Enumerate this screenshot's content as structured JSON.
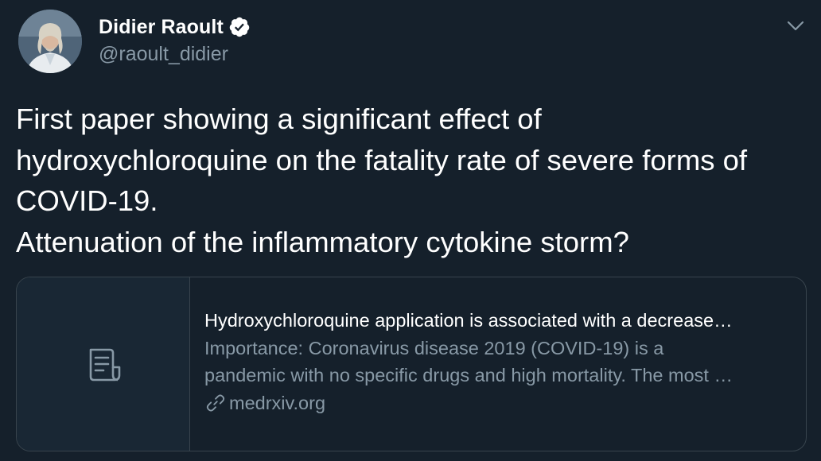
{
  "author": {
    "display_name": "Didier Raoult",
    "handle": "@raoult_didier",
    "verified": true
  },
  "tweet": {
    "lines": [
      "First paper showing a significant effect of",
      "hydroxychloroquine on the fatality rate of severe forms of",
      "COVID-19.",
      "Attenuation of the inflammatory cytokine storm?"
    ]
  },
  "card": {
    "title": "Hydroxychloroquine application is associated with a decrease…",
    "description_lines": [
      "Importance: Coronavirus disease 2019 (COVID-19) is a",
      "pandemic with no specific drugs and high mortality. The most …"
    ],
    "domain": "medrxiv.org",
    "thumbnail_icon": "document-icon"
  },
  "icons": {
    "verified": "verified-badge-icon",
    "menu": "chevron-down-icon",
    "link": "link-icon"
  },
  "colors": {
    "background": "#15202b",
    "text_primary": "#ffffff",
    "text_secondary": "#8899a6",
    "border": "#38444d"
  }
}
